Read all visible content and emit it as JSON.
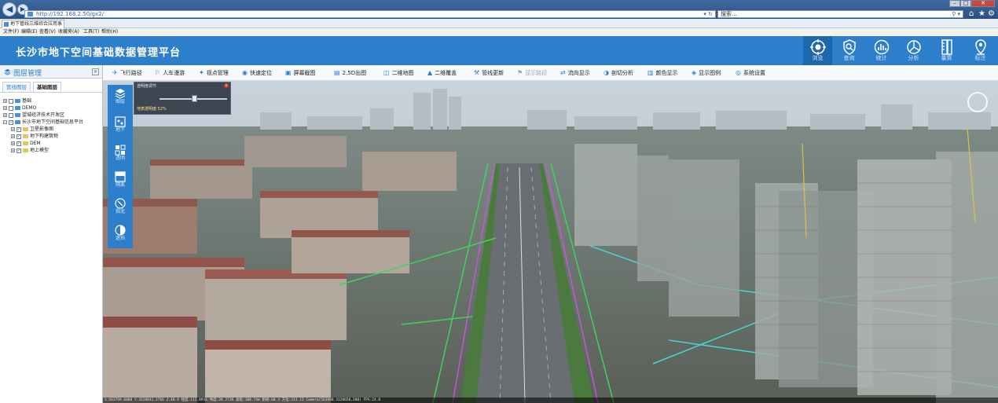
{
  "browser": {
    "url": "http://192.168.2.50/gx2/",
    "search_placeholder": "搜索...",
    "tab_title": "地下管线三维综合应用系统",
    "menu": [
      "文件(F)",
      "编辑(E)",
      "查看(V)",
      "收藏夹(A)",
      "工具(T)",
      "帮助(H)"
    ],
    "icons": [
      "back-icon",
      "forward-icon",
      "refresh-icon",
      "search-icon",
      "home-icon",
      "star-icon",
      "gear-icon"
    ]
  },
  "header": {
    "title": "长沙市地下空间基础数据管理平台",
    "buttons": [
      {
        "label": "浏览",
        "icon": "crosshair-icon",
        "active": true
      },
      {
        "label": "查询",
        "icon": "shield-search-icon",
        "active": false
      },
      {
        "label": "统计",
        "icon": "bar-chart-icon",
        "active": false
      },
      {
        "label": "分析",
        "icon": "pie-chart-icon",
        "active": false
      },
      {
        "label": "量算",
        "icon": "ruler-icon",
        "active": false
      },
      {
        "label": "标注",
        "icon": "map-pin-icon",
        "active": false
      }
    ]
  },
  "sidebar": {
    "title": "图层管理",
    "tabs": [
      {
        "label": "管线图层",
        "active": false
      },
      {
        "label": "基础图层",
        "active": true
      }
    ],
    "tree": [
      {
        "label": "基础",
        "level": 0,
        "checked": false
      },
      {
        "label": "DEMO",
        "level": 0,
        "checked": false
      },
      {
        "label": "望城经济技术开发区",
        "level": 0,
        "checked": false
      },
      {
        "label": "长沙市地下空间基础信息平台",
        "level": 0,
        "checked": true
      },
      {
        "label": "卫星影像图",
        "level": 1,
        "checked": true
      },
      {
        "label": "地下构建筑物",
        "level": 1,
        "checked": true
      },
      {
        "label": "DEM",
        "level": 1,
        "checked": true
      },
      {
        "label": "地上模型",
        "level": 1,
        "checked": true
      }
    ]
  },
  "toolbar": {
    "items": [
      {
        "label": "飞行路径",
        "enabled": true
      },
      {
        "label": "人车漫游",
        "enabled": true
      },
      {
        "label": "视点管理",
        "enabled": true
      },
      {
        "label": "快速定位",
        "enabled": true
      },
      {
        "label": "屏幕截图",
        "enabled": true
      },
      {
        "label": "2.5D出图",
        "enabled": true
      },
      {
        "label": "二维地图",
        "enabled": true
      },
      {
        "label": "二维覆盖",
        "enabled": true
      },
      {
        "label": "管线更新",
        "enabled": true
      },
      {
        "label": "显示路径",
        "enabled": false
      },
      {
        "label": "流向显示",
        "enabled": true
      },
      {
        "label": "剖切分析",
        "enabled": true
      },
      {
        "label": "颜色显示",
        "enabled": true
      },
      {
        "label": "显示图例",
        "enabled": true
      },
      {
        "label": "系统设置",
        "enabled": true
      }
    ]
  },
  "vtoolbar": {
    "buttons": [
      {
        "label": "图层",
        "icon": "layers-icon"
      },
      {
        "label": "地下",
        "icon": "underground-icon"
      },
      {
        "label": "透明",
        "icon": "transparency-icon"
      },
      {
        "label": "隔离",
        "icon": "isolate-icon"
      },
      {
        "label": "指北",
        "icon": "compass-icon"
      },
      {
        "label": "遮挡",
        "icon": "half-circle-icon"
      }
    ]
  },
  "popup": {
    "title": "透明度调节",
    "value_label": "地表透明度:52%",
    "value": 0.52
  },
  "statusbar": {
    "text": "X:563769.6860  Y:3128841.2766  Z:40.8  经度:112.8916  纬度:28.2736  高程:108.74m  俯视:60.3  方位:213.13  Camera(563900,3128650,280)  FPS:24.0"
  }
}
